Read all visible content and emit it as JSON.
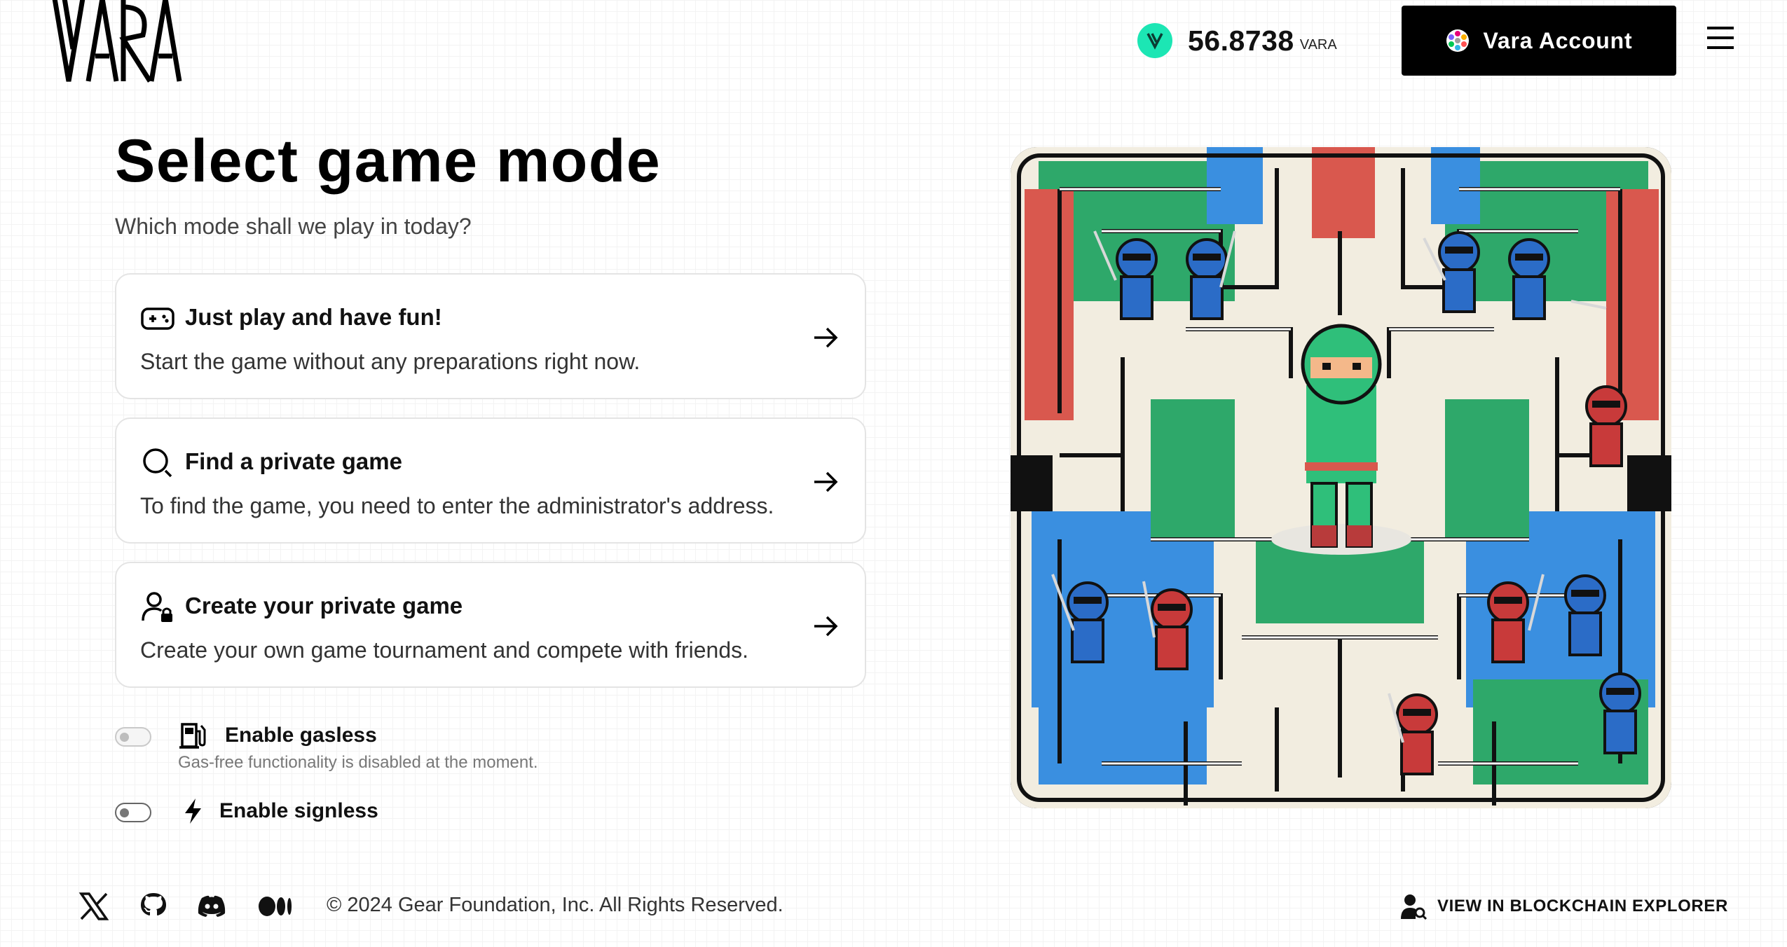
{
  "header": {
    "logo_text": "VARA",
    "balance_amount": "56.8738",
    "balance_unit": "VARA",
    "account_label": "Vara Account"
  },
  "main": {
    "title": "Select game mode",
    "subtitle": "Which mode shall we play in today?",
    "modes": [
      {
        "title": "Just play and have fun!",
        "description": "Start the game without any preparations right now.",
        "icon": "gamepad-icon"
      },
      {
        "title": "Find a private game",
        "description": "To find the game, you need to enter the administrator's address.",
        "icon": "search-icon"
      },
      {
        "title": "Create your private game",
        "description": "Create your own game tournament and compete with friends.",
        "icon": "user-lock-icon"
      }
    ],
    "options": {
      "gasless": {
        "label": "Enable gasless",
        "note": "Gas-free functionality is disabled at the moment.",
        "icon": "gas-station-icon",
        "enabled": false,
        "disabled": true
      },
      "signless": {
        "label": "Enable signless",
        "icon": "lightning-icon",
        "enabled": false
      }
    }
  },
  "footer": {
    "social": [
      "x-icon",
      "github-icon",
      "discord-icon",
      "medium-icon"
    ],
    "copyright": "© 2024 Gear Foundation, Inc. All Rights Reserved.",
    "explorer_label": "VIEW IN BLOCKCHAIN EXPLORER"
  },
  "colors": {
    "accent": "#000000",
    "vara_green": "#1ce6b4",
    "card_border": "#e4e4e4"
  }
}
